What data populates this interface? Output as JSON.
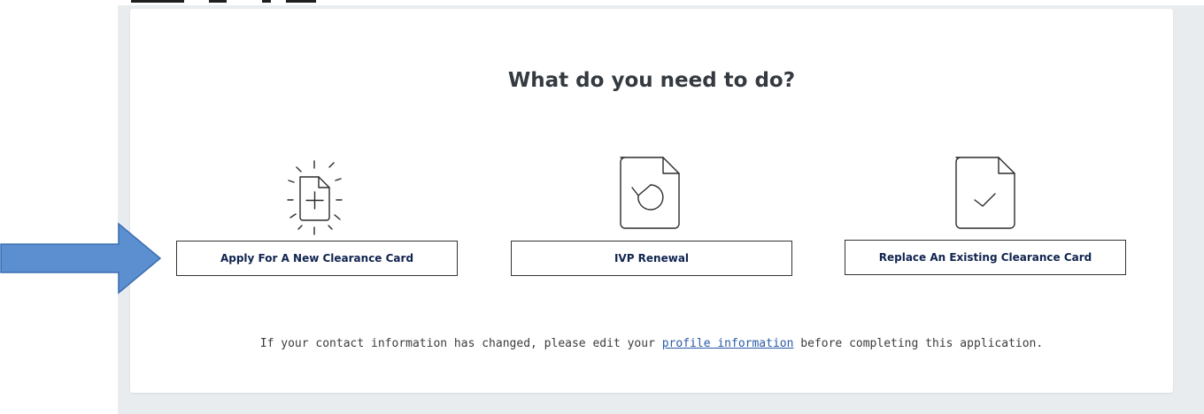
{
  "page": {
    "heading": "What do you need to do?"
  },
  "options": [
    {
      "label": "Apply For A New Clearance Card",
      "icon": "new-document-icon"
    },
    {
      "label": "IVP Renewal",
      "icon": "renew-document-icon"
    },
    {
      "label": "Replace An Existing Clearance Card",
      "icon": "approved-document-icon"
    }
  ],
  "footer": {
    "text_before": "If your contact information has changed, please edit your ",
    "link_text": "profile information",
    "text_after": " before completing this application."
  },
  "annotation": {
    "arrow": "arrow-pointer-icon",
    "arrow_color": "#5b8fd0"
  }
}
